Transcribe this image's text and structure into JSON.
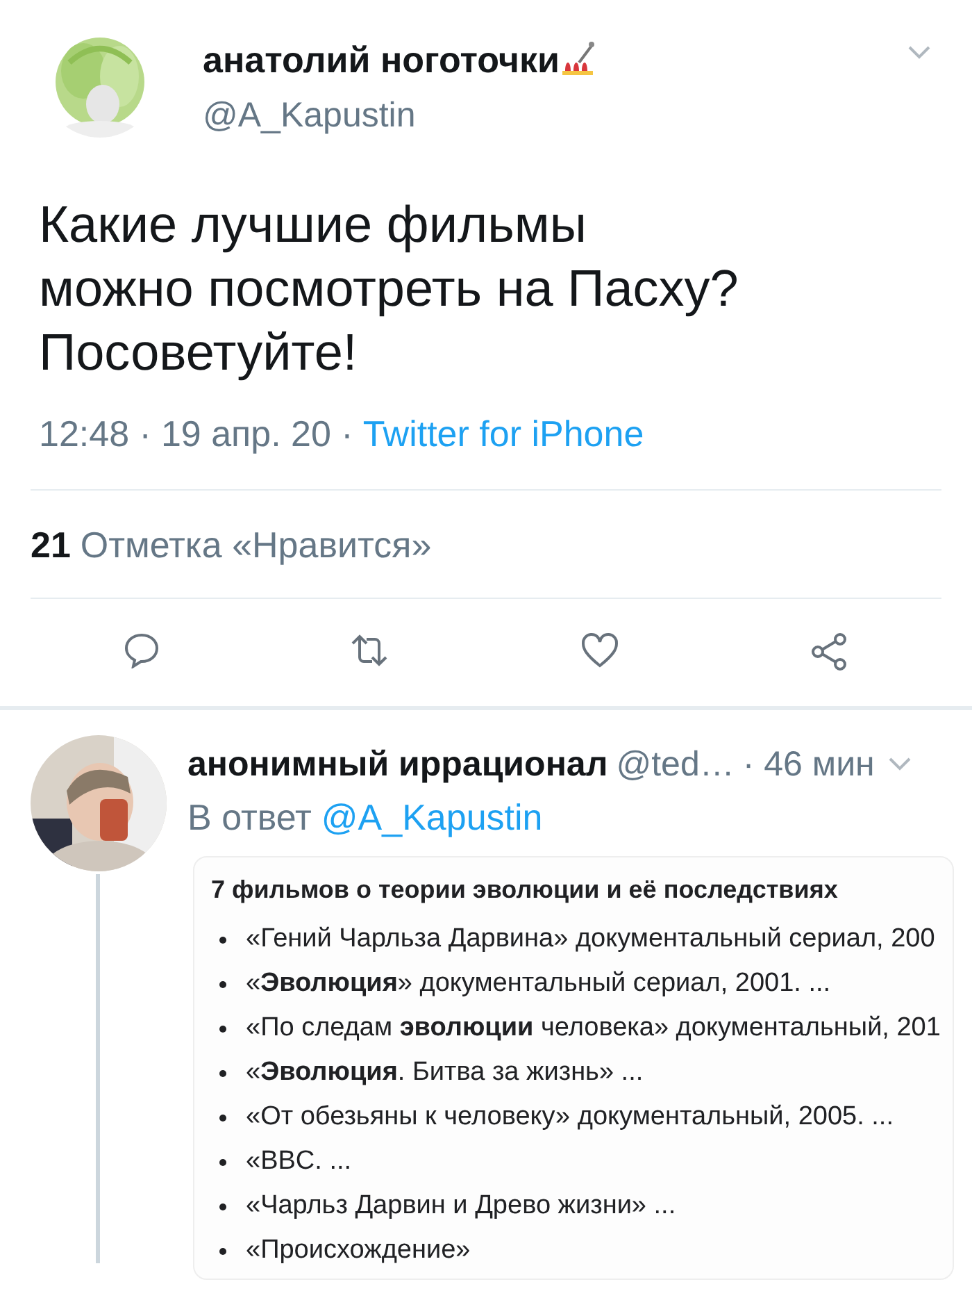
{
  "tweet": {
    "author": {
      "name": "анатолий ноготочки",
      "handle": "@A_Kapustin"
    },
    "text_lines": [
      "Какие лучшие фильмы",
      "можно посмотреть на Пасху?",
      "Посоветуйте!"
    ],
    "time": "12:48 ·",
    "date": "19 апр. 20 ·",
    "source": "Twitter for iPhone",
    "likes": {
      "count": "21",
      "label": "Отметка «Нравится»"
    },
    "actions": [
      {
        "kind": "reply"
      },
      {
        "kind": "retweet"
      },
      {
        "kind": "like"
      },
      {
        "kind": "share"
      }
    ]
  },
  "reply": {
    "author": {
      "name": "анонимный иррационал",
      "handle": "@ted…"
    },
    "age": "· 46 мин",
    "in_reply_prefix": "В ответ",
    "in_reply_to": "@A_Kapustin",
    "card": {
      "title": "7 фильмов о теории эволюции и её последствиях",
      "items": [
        "«Гений Чарльза Дарвина» документальный сериал, 200",
        "«**Эволюция**» документальный сериал, 2001. ...",
        "«По следам **эволюции** человека» документальный, 201",
        "«**Эволюция**. Битва за жизнь» ...",
        "«От обезьяны к человеку» документальный, 2005. ...",
        "«BBC. ...",
        "«Чарльз Дарвин и Древо жизни» ...",
        "«Происхождение»"
      ]
    }
  }
}
